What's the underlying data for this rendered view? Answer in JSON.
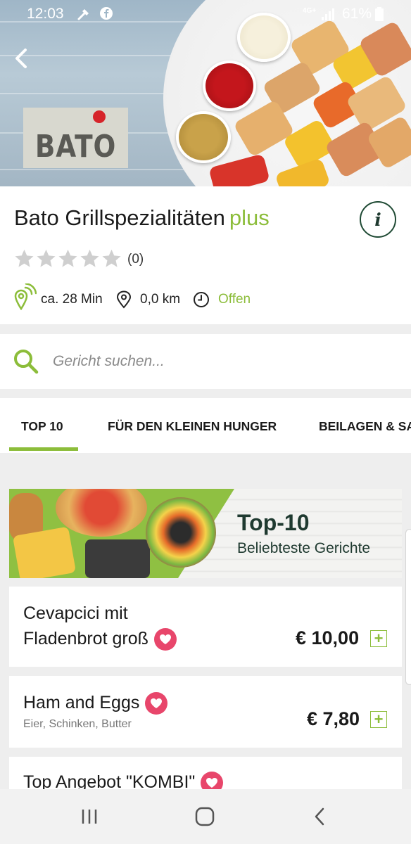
{
  "status_bar": {
    "time": "12:03",
    "network": "4G+",
    "battery": "61%"
  },
  "restaurant": {
    "logo_text": "BATO",
    "name": "Bato Grillspezialitäten",
    "badge": "plus",
    "rating_count": "(0)",
    "stars_filled": 0,
    "stars_total": 5,
    "delivery_time": "ca. 28 Min",
    "distance": "0,0 km",
    "status": "Offen",
    "info_button": "i"
  },
  "search": {
    "placeholder": "Gericht suchen..."
  },
  "tabs": [
    {
      "label": "TOP 10",
      "active": true
    },
    {
      "label": "FÜR DEN KLEINEN HUNGER",
      "active": false
    },
    {
      "label": "BEILAGEN & SA",
      "active": false
    }
  ],
  "banner": {
    "title": "Top-10",
    "subtitle": "Beliebteste Gerichte"
  },
  "menu_items": [
    {
      "name_line1": "Cevapcici mit",
      "name_line2": "Fladenbrot groß",
      "description": "",
      "price": "€ 10,00",
      "favorite": true
    },
    {
      "name_line1": "Ham and Eggs",
      "name_line2": "",
      "description": "Eier, Schinken, Butter",
      "price": "€ 7,80",
      "favorite": true
    },
    {
      "name_line1": "Top Angebot \"KOMBI\"",
      "name_line2": "",
      "description": "",
      "price": "",
      "favorite": true
    }
  ],
  "colors": {
    "accent": "#8cbd3a",
    "favorite": "#e8466b",
    "dark_green": "#1f3a30"
  },
  "icons": [
    "back-arrow-icon",
    "info-icon",
    "star-icon",
    "delivery-pin-icon",
    "location-pin-icon",
    "clock-icon",
    "search-icon",
    "heart-icon",
    "plus-icon",
    "recents-icon",
    "home-icon",
    "nav-back-icon"
  ]
}
